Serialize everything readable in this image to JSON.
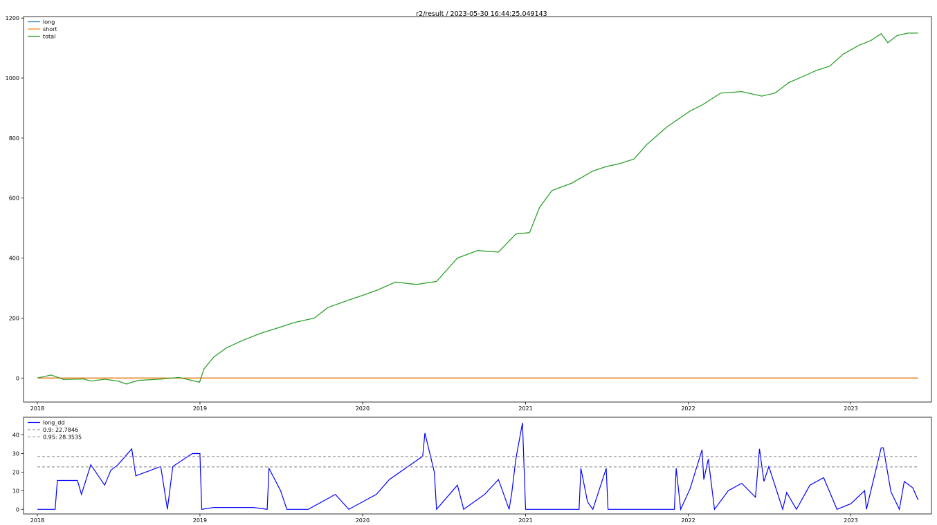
{
  "chart_data": [
    {
      "type": "line",
      "title": "r2/result / 2023-05-30 16:44:25.049143",
      "xlabel": "",
      "ylabel": "",
      "x_range": [
        "2017-12-01",
        "2023-07-01"
      ],
      "xticks": [
        {
          "date": "2018-01-01",
          "label": "2018"
        },
        {
          "date": "2019-01-01",
          "label": "2019"
        },
        {
          "date": "2020-01-01",
          "label": "2020"
        },
        {
          "date": "2021-01-01",
          "label": "2021"
        },
        {
          "date": "2022-01-01",
          "label": "2022"
        },
        {
          "date": "2023-01-01",
          "label": "2023"
        }
      ],
      "ylim": [
        -80,
        1205
      ],
      "yticks": [
        0,
        200,
        400,
        600,
        800,
        1000,
        1200
      ],
      "grid": false,
      "legend_position": "top-left",
      "series": [
        {
          "name": "long",
          "color": "#1f77b4",
          "width": 1.3,
          "x": [
            "2018-01-01",
            "2023-06-01"
          ],
          "y": [
            0,
            0
          ]
        },
        {
          "name": "short",
          "color": "#ff7f0e",
          "width": 1.3,
          "x": [
            "2018-01-01",
            "2023-06-01"
          ],
          "y": [
            0,
            0
          ]
        },
        {
          "name": "total",
          "color": "#2ca02c",
          "width": 1.3,
          "x": [
            "2018-01-01",
            "2018-02-01",
            "2018-03-01",
            "2018-04-15",
            "2018-05-01",
            "2018-06-01",
            "2018-07-01",
            "2018-07-20",
            "2018-08-15",
            "2018-10-01",
            "2018-11-15",
            "2018-12-31",
            "2019-01-10",
            "2019-02-01",
            "2019-03-01",
            "2019-04-01",
            "2019-05-15",
            "2019-07-01",
            "2019-08-01",
            "2019-09-15",
            "2019-10-15",
            "2019-12-01",
            "2020-02-01",
            "2020-03-15",
            "2020-05-01",
            "2020-06-15",
            "2020-08-01",
            "2020-09-15",
            "2020-11-01",
            "2020-12-10",
            "2021-01-10",
            "2021-02-01",
            "2021-03-01",
            "2021-04-15",
            "2021-06-01",
            "2021-07-01",
            "2021-08-01",
            "2021-09-01",
            "2021-10-01",
            "2021-11-15",
            "2022-01-05",
            "2022-02-01",
            "2022-03-15",
            "2022-05-01",
            "2022-06-15",
            "2022-07-15",
            "2022-08-15",
            "2022-09-15",
            "2022-10-15",
            "2022-11-15",
            "2022-12-15",
            "2023-01-20",
            "2023-02-15",
            "2023-03-10",
            "2023-03-25",
            "2023-04-15",
            "2023-05-10",
            "2023-06-01"
          ],
          "y": [
            0,
            10,
            -5,
            -3,
            -10,
            -4,
            -10,
            -20,
            -8,
            -4,
            2,
            -14,
            30,
            70,
            100,
            122,
            148,
            170,
            185,
            200,
            235,
            260,
            292,
            320,
            312,
            322,
            400,
            425,
            420,
            480,
            485,
            568,
            625,
            650,
            690,
            705,
            715,
            730,
            780,
            838,
            890,
            910,
            950,
            955,
            940,
            950,
            985,
            1005,
            1025,
            1040,
            1080,
            1110,
            1125,
            1148,
            1118,
            1142,
            1150,
            1150
          ]
        }
      ]
    },
    {
      "type": "line",
      "title": "",
      "xlabel": "",
      "ylabel": "",
      "x_range": [
        "2017-12-01",
        "2023-07-01"
      ],
      "xticks": [
        {
          "date": "2018-01-01",
          "label": "2018"
        },
        {
          "date": "2019-01-01",
          "label": "2019"
        },
        {
          "date": "2020-01-01",
          "label": "2020"
        },
        {
          "date": "2021-01-01",
          "label": "2021"
        },
        {
          "date": "2022-01-01",
          "label": "2022"
        },
        {
          "date": "2023-01-01",
          "label": "2023"
        }
      ],
      "ylim": [
        -2.5,
        49.5
      ],
      "yticks": [
        0,
        10,
        20,
        30,
        40
      ],
      "grid": false,
      "legend_position": "top-left",
      "series": [
        {
          "name": "long_dd",
          "color": "#0000ff",
          "width": 1.2,
          "x": [
            "2018-01-01",
            "2018-02-10",
            "2018-02-15",
            "2018-04-01",
            "2018-04-10",
            "2018-05-01",
            "2018-06-01",
            "2018-06-15",
            "2018-07-01",
            "2018-08-01",
            "2018-08-10",
            "2018-10-05",
            "2018-10-20",
            "2018-11-01",
            "2018-12-15",
            "2019-01-01",
            "2019-01-05",
            "2019-02-01",
            "2019-05-01",
            "2019-06-01",
            "2019-06-05",
            "2019-07-01",
            "2019-07-15",
            "2019-09-01",
            "2019-11-01",
            "2019-12-01",
            "2020-01-01",
            "2020-02-01",
            "2020-03-01",
            "2020-05-15",
            "2020-05-20",
            "2020-06-10",
            "2020-06-15",
            "2020-08-01",
            "2020-08-15",
            "2020-10-01",
            "2020-11-01",
            "2020-11-25",
            "2020-12-01",
            "2020-12-10",
            "2020-12-25",
            "2021-01-01",
            "2021-05-01",
            "2021-05-05",
            "2021-05-20",
            "2021-06-01",
            "2021-07-01",
            "2021-07-05",
            "2021-07-20",
            "2021-09-01",
            "2021-12-01",
            "2021-12-05",
            "2021-12-15",
            "2022-01-05",
            "2022-02-01",
            "2022-02-05",
            "2022-02-15",
            "2022-03-01",
            "2022-04-01",
            "2022-05-01",
            "2022-06-01",
            "2022-06-10",
            "2022-06-20",
            "2022-07-01",
            "2022-08-01",
            "2022-08-10",
            "2022-09-01",
            "2022-10-01",
            "2022-11-01",
            "2022-12-01",
            "2023-01-01",
            "2023-02-01",
            "2023-02-05",
            "2023-03-10",
            "2023-03-15",
            "2023-04-01",
            "2023-04-20",
            "2023-05-01",
            "2023-05-20",
            "2023-06-01"
          ],
          "y": [
            0,
            0,
            15.5,
            15.5,
            8,
            24,
            13,
            21,
            24,
            32.5,
            18,
            23,
            0,
            23,
            30,
            30,
            0,
            1,
            1,
            0,
            22,
            10,
            0,
            0,
            8,
            0,
            4,
            8,
            16,
            28.5,
            41,
            20,
            0,
            13,
            0,
            8,
            16,
            0,
            9,
            27,
            46.5,
            0,
            0,
            22,
            4,
            0,
            22,
            0,
            0,
            0,
            0,
            22,
            0,
            11,
            32,
            16,
            27,
            0,
            10,
            14,
            6.5,
            32.5,
            15,
            23,
            0,
            9,
            0,
            13,
            17,
            0,
            3,
            10,
            0,
            33,
            33,
            9.5,
            0,
            15,
            11.5,
            5
          ]
        },
        {
          "name": "0.9: 22.7846",
          "color": "#808080",
          "dash": "4,3",
          "width": 1.0,
          "x": [
            "2018-01-01",
            "2023-06-01"
          ],
          "y": [
            22.7846,
            22.7846
          ]
        },
        {
          "name": "0.95: 28.3535",
          "color": "#808080",
          "dash": "4,3",
          "width": 1.0,
          "x": [
            "2018-01-01",
            "2023-06-01"
          ],
          "y": [
            28.3535,
            28.3535
          ]
        }
      ]
    }
  ]
}
